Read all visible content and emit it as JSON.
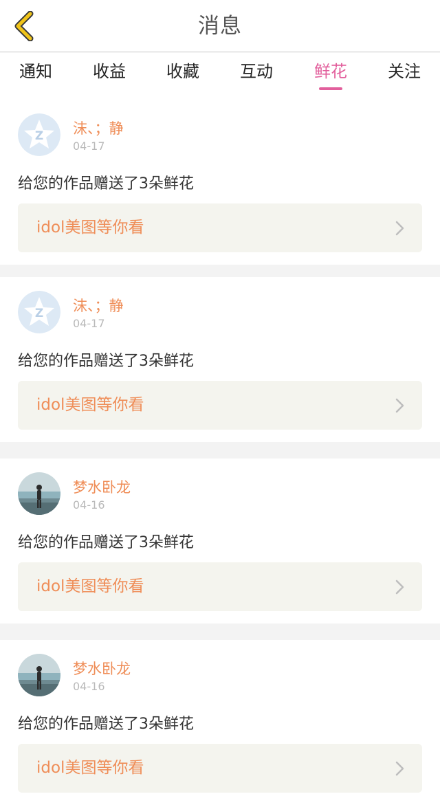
{
  "header": {
    "title": "消息",
    "back_icon": "chevron-left-icon",
    "back_color": "#f0c419"
  },
  "tabs": [
    {
      "label": "通知",
      "active": false
    },
    {
      "label": "收益",
      "active": false
    },
    {
      "label": "收藏",
      "active": false
    },
    {
      "label": "互动",
      "active": false
    },
    {
      "label": "鲜花",
      "active": true
    },
    {
      "label": "关注",
      "active": false
    }
  ],
  "colors": {
    "accent": "#e25f9c",
    "name": "#ef8d57",
    "link_bg": "#f4f4ee"
  },
  "notifications": [
    {
      "user": "沫、；静",
      "date": "04-17",
      "message": "给您的作品赠送了3朵鲜花",
      "link": "idol美图等你看",
      "avatar": "qq-default-avatar-icon"
    },
    {
      "user": "沫、；静",
      "date": "04-17",
      "message": "给您的作品赠送了3朵鲜花",
      "link": "idol美图等你看",
      "avatar": "qq-default-avatar-icon"
    },
    {
      "user": "梦水卧龙",
      "date": "04-16",
      "message": "给您的作品赠送了3朵鲜花",
      "link": "idol美图等你看",
      "avatar": "beach-photo-avatar"
    },
    {
      "user": "梦水卧龙",
      "date": "04-16",
      "message": "给您的作品赠送了3朵鲜花",
      "link": "idol美图等你看",
      "avatar": "beach-photo-avatar"
    }
  ]
}
